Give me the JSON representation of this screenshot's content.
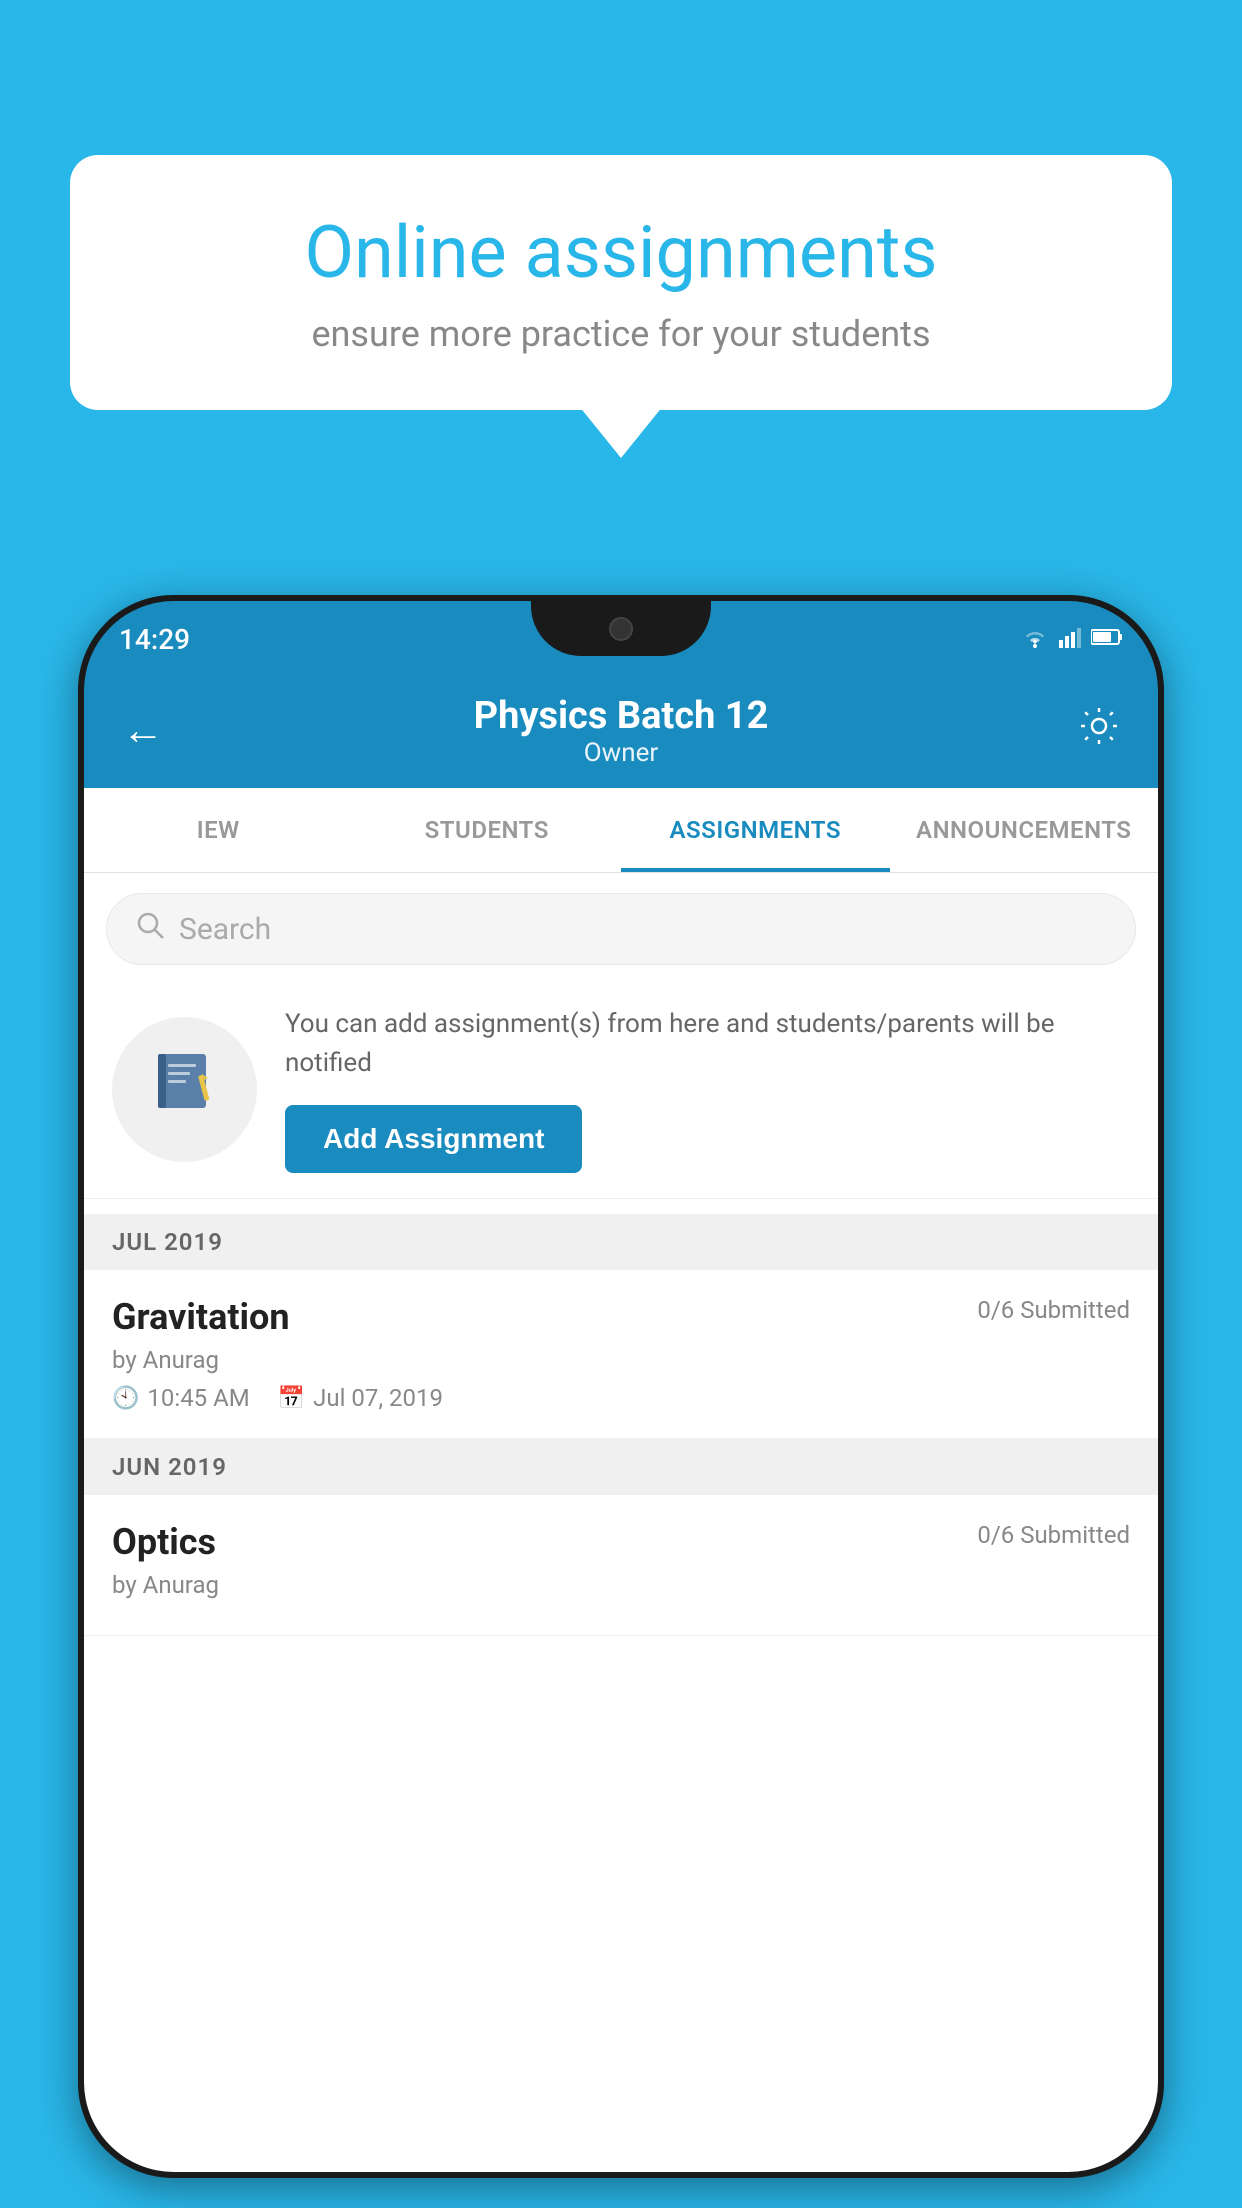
{
  "background_color": "#29b6e8",
  "speech_bubble": {
    "title": "Online assignments",
    "subtitle": "ensure more practice for your students"
  },
  "status_bar": {
    "time": "14:29",
    "icons": [
      "wifi",
      "signal",
      "battery"
    ]
  },
  "app_bar": {
    "title": "Physics Batch 12",
    "subtitle": "Owner",
    "back_label": "←",
    "settings_label": "⚙"
  },
  "tabs": [
    {
      "label": "IEW",
      "active": false
    },
    {
      "label": "STUDENTS",
      "active": false
    },
    {
      "label": "ASSIGNMENTS",
      "active": true
    },
    {
      "label": "ANNOUNCEMENTS",
      "active": false
    }
  ],
  "search": {
    "placeholder": "Search"
  },
  "add_assignment_section": {
    "description": "You can add assignment(s) from here and students/parents will be notified",
    "button_label": "Add Assignment"
  },
  "assignment_groups": [
    {
      "month": "JUL 2019",
      "assignments": [
        {
          "name": "Gravitation",
          "submitted": "0/6 Submitted",
          "by": "by Anurag",
          "time": "10:45 AM",
          "date": "Jul 07, 2019"
        }
      ]
    },
    {
      "month": "JUN 2019",
      "assignments": [
        {
          "name": "Optics",
          "submitted": "0/6 Submitted",
          "by": "by Anurag",
          "time": "",
          "date": ""
        }
      ]
    }
  ]
}
